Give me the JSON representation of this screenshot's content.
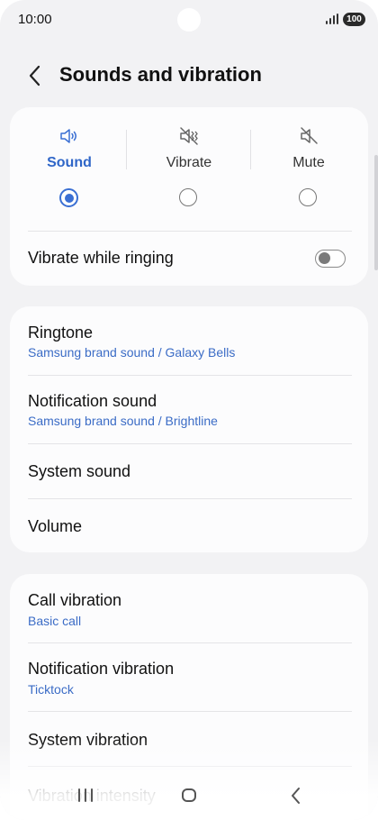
{
  "status_bar": {
    "time": "10:00",
    "battery": "100"
  },
  "header": {
    "title": "Sounds and vibration"
  },
  "sound_modes": [
    {
      "label": "Sound",
      "selected": true,
      "icon": "speaker-icon"
    },
    {
      "label": "Vibrate",
      "selected": false,
      "icon": "vibrate-icon"
    },
    {
      "label": "Mute",
      "selected": false,
      "icon": "mute-icon"
    }
  ],
  "vibrate_while_ringing": {
    "label": "Vibrate while ringing",
    "enabled": false
  },
  "sound_settings": {
    "ringtone": {
      "label": "Ringtone",
      "value": "Samsung brand sound / Galaxy Bells"
    },
    "notification_sound": {
      "label": "Notification sound",
      "value": "Samsung brand sound / Brightline"
    },
    "system_sound": {
      "label": "System sound"
    },
    "volume": {
      "label": "Volume"
    }
  },
  "vibration_settings": {
    "call_vibration": {
      "label": "Call vibration",
      "value": "Basic call"
    },
    "notification_vibration": {
      "label": "Notification vibration",
      "value": "Ticktock"
    },
    "system_vibration": {
      "label": "System vibration"
    },
    "vibration_intensity": {
      "label": "Vibration intensity"
    }
  },
  "colors": {
    "accent": "#3a6fd3",
    "subtext": "#3b6cc6",
    "background": "#f2f2f4",
    "card": "#fcfcfd"
  },
  "navigation_bar": {
    "icons": [
      "recents-icon",
      "home-icon",
      "back-icon"
    ]
  }
}
